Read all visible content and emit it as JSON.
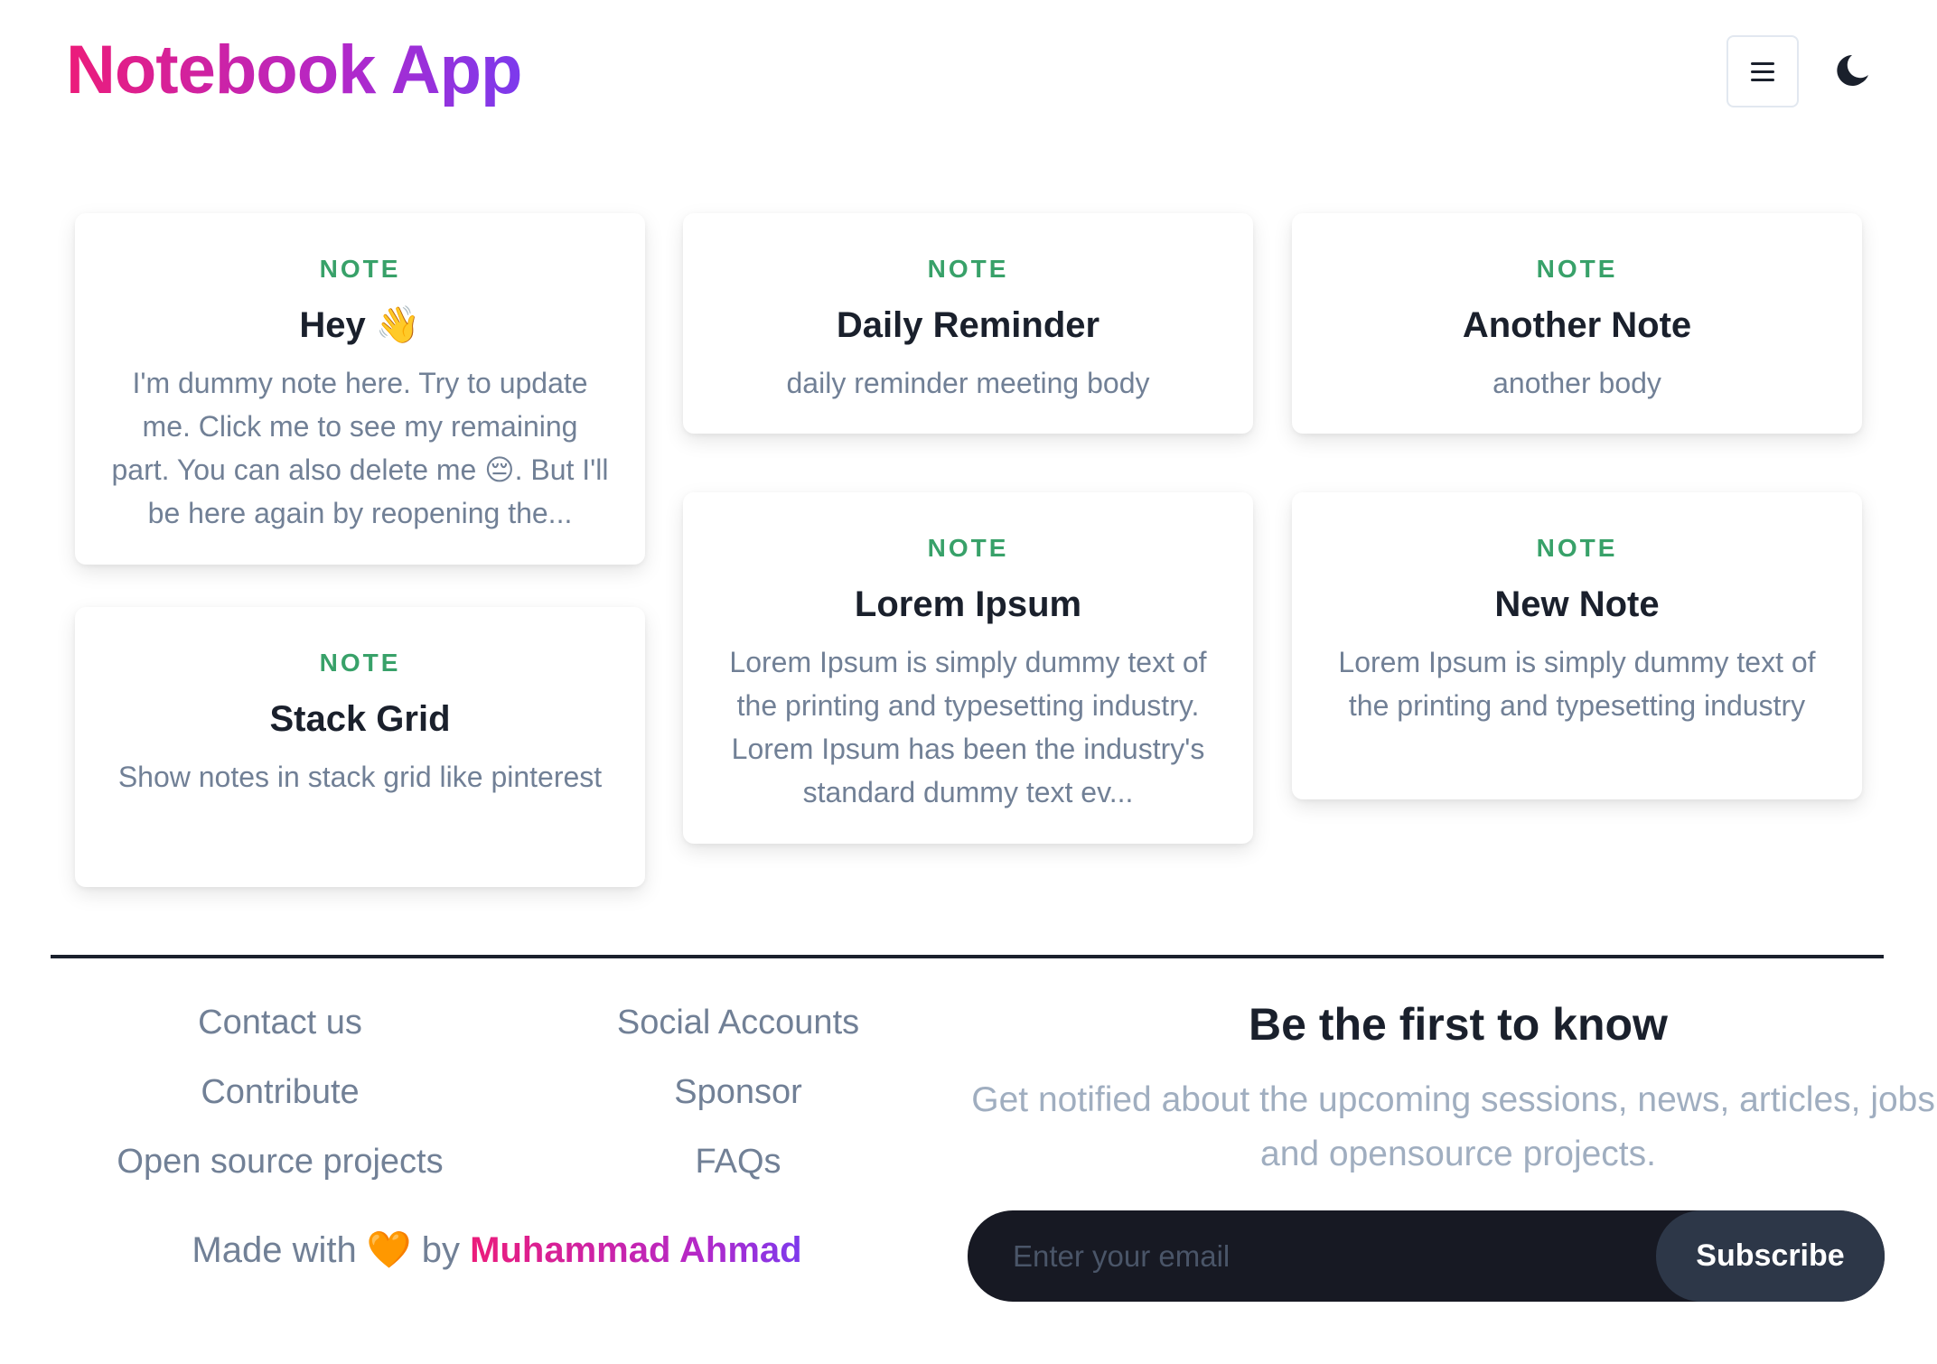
{
  "app": {
    "title": "Notebook App"
  },
  "header": {
    "menu_icon": "hamburger-menu-icon",
    "theme_icon": "moon-icon"
  },
  "notes": [
    {
      "tag": "NOTE",
      "title": "Hey 👋",
      "body": "I'm dummy note here. Try to update me. Click me to see my remaining part. You can also delete me 😔. But I'll be here again by reopening the..."
    },
    {
      "tag": "NOTE",
      "title": "Daily Reminder",
      "body": "daily reminder meeting body"
    },
    {
      "tag": "NOTE",
      "title": "Another Note",
      "body": "another body"
    },
    {
      "tag": "NOTE",
      "title": "Stack Grid",
      "body": "Show notes in stack grid like pinterest"
    },
    {
      "tag": "NOTE",
      "title": "Lorem Ipsum",
      "body": "Lorem Ipsum is simply dummy text of the printing and typesetting industry. Lorem Ipsum has been the industry's standard dummy text ev..."
    },
    {
      "tag": "NOTE",
      "title": "New Note",
      "body": "Lorem Ipsum is simply dummy text of the printing and typesetting industry"
    }
  ],
  "footer": {
    "links_col1": [
      "Contact us",
      "Contribute",
      "Open source projects"
    ],
    "links_col2": [
      "Social Accounts",
      "Sponsor",
      "FAQs"
    ],
    "made_with_prefix": "Made with",
    "heart": "🧡",
    "made_with_by": "by",
    "author": "Muhammad Ahmad"
  },
  "subscribe": {
    "title": "Be the first to know",
    "description": "Get notified about the upcoming sessions, news, articles, jobs, and opensource projects.",
    "email_placeholder": "Enter your email",
    "button_label": "Subscribe"
  },
  "colors": {
    "tag_green": "#38a169",
    "form_dark": "#171923",
    "button_dark": "#2d3748",
    "brand_gradient_start": "#ec1c7a",
    "brand_gradient_end": "#7c3aed"
  }
}
